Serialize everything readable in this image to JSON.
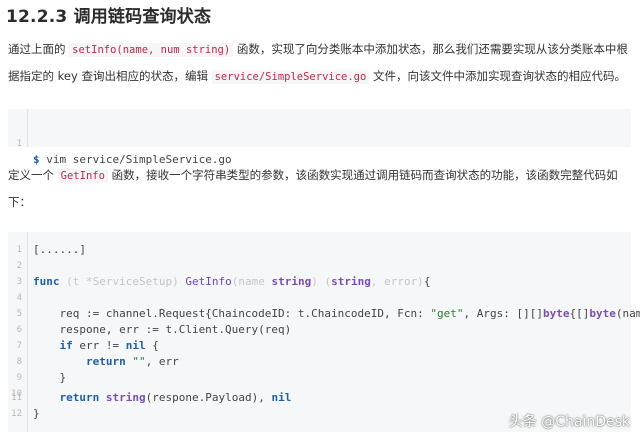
{
  "heading": "12.2.3 调用链码查询状态",
  "para1": {
    "t1": "通过上面的 ",
    "c1": "setInfo(name, num string)",
    "t2": " 函数，实现了向分类账本中添加状态，那么我们还需要实现从该分类账本中根据指定的 key 查询出相应的状态，编辑 ",
    "c2": "service/SimpleService.go",
    "t3": " 文件，向该文件中添加实现查询状态的相应代码。"
  },
  "cmd_block": {
    "line_no": "1",
    "prompt": "$",
    "command": " vim service/SimpleService.go"
  },
  "para2": {
    "t1": "定义一个 ",
    "c1": "GetInfo",
    "t2": " 函数，接收一个字符串类型的参数，该函数实现通过调用链码而查询状态的功能，该函数完整代码如下："
  },
  "code": {
    "line_numbers": [
      "1",
      "2",
      "3",
      "4",
      "5",
      "6",
      "7",
      "8",
      "9",
      "10",
      "11",
      "12"
    ],
    "l1": "[......]",
    "l3": {
      "kw_func": "func",
      "recv": " (t *ServiceSetup) ",
      "name": "GetInfo",
      "param_open": "(name ",
      "param_type": "string",
      "param_close": ") ",
      "ret_open": "(",
      "ret_type": "string",
      "ret_rest": ", error)",
      "brace": "{"
    },
    "l5": {
      "a": "    req := channel.Request{ChaincodeID: t.ChaincodeID, Fcn: ",
      "str": "\"get\"",
      "b": ", Args: [][]",
      "kw1": "byte",
      "c": "{[]",
      "kw2": "byte",
      "d": "(name)}}"
    },
    "l6": "    respone, err := t.Client.Query(req)",
    "l7": {
      "kw": "if",
      "rest": " err != ",
      "kw2": "nil",
      "end": " {"
    },
    "l8": {
      "kw": "return",
      "str": " \"\"",
      "rest": ", err"
    },
    "l9": "    }",
    "l11": {
      "kw": "return",
      "typ": " string",
      "rest": "(respone.Payload), ",
      "kw2": "nil"
    },
    "l12": "}"
  },
  "watermark": "头条 @ChainDesk"
}
